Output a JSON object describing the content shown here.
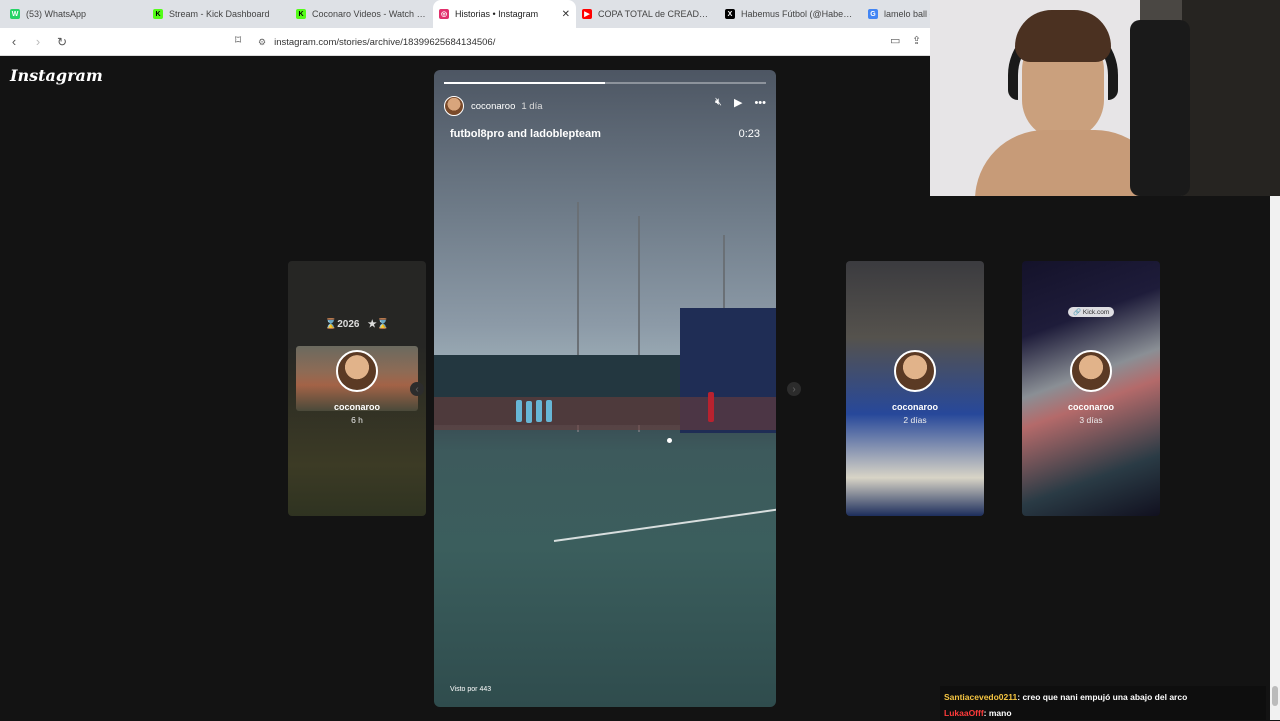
{
  "browser": {
    "tabs": [
      {
        "title": "(53) WhatsApp",
        "color": "#25d366",
        "glyph": "W",
        "active": false
      },
      {
        "title": "Stream - Kick Dashboard",
        "color": "#53fc18",
        "glyph": "K",
        "active": false
      },
      {
        "title": "Coconaro Videos - Watch On-K",
        "color": "#53fc18",
        "glyph": "K",
        "active": false
      },
      {
        "title": "Historias • Instagram",
        "color": "#e1306c",
        "glyph": "◎",
        "active": true
      },
      {
        "title": "COPA TOTAL de CREADORES d",
        "color": "#ff0000",
        "glyph": "▶",
        "active": false
      },
      {
        "title": "Habemus Fútbol (@Habemus)",
        "color": "#000000",
        "glyph": "X",
        "active": false
      },
      {
        "title": "lamelo ball - B",
        "color": "#4285f4",
        "glyph": "G",
        "active": false
      }
    ],
    "url": "instagram.com/stories/archive/18399625684134506/"
  },
  "instagram": {
    "logo": "Instagram",
    "story": {
      "username": "coconaroo",
      "time": "1 día",
      "caption": "futbol8pro and ladoblepteam",
      "duration": "0:23",
      "views": "Visto por 443",
      "progress": 0.5
    },
    "cards": [
      {
        "username": "coconaroo",
        "time": "6 h",
        "overlay_text": "2026"
      },
      {
        "username": "coconaroo",
        "time": "2 días"
      },
      {
        "username": "coconaroo",
        "time": "3 días",
        "overlay_text": "Kick.com"
      }
    ]
  },
  "chat": {
    "messages": [
      {
        "user": "Santiacevedo0211",
        "text": ": creo que nani empujó una abajo del arco",
        "color": "#f5c542"
      },
      {
        "user": "LukaaOfff",
        "text": ": mano",
        "color": "#ff3b3b"
      }
    ]
  }
}
